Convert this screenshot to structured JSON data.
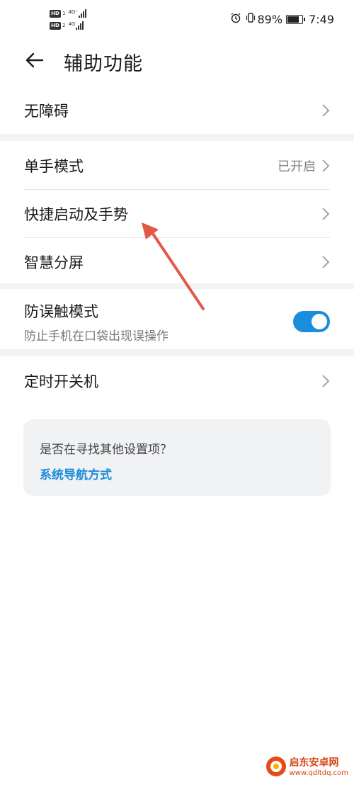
{
  "status_bar": {
    "sim1": {
      "badge": "HD",
      "num": "1",
      "net": "4G⁺"
    },
    "sim2": {
      "badge": "HD",
      "num": "2",
      "net": "4G"
    },
    "battery": "89%",
    "time": "7:49",
    "icons": [
      "alarm-icon",
      "vibrate-icon",
      "battery-icon"
    ]
  },
  "header": {
    "title": "辅助功能",
    "back_icon": "arrow-left-icon"
  },
  "groups": {
    "accessibility": {
      "label": "无障碍"
    },
    "one_hand": {
      "label": "单手模式",
      "value": "已开启"
    },
    "quick_launch": {
      "label": "快捷启动及手势"
    },
    "smart_split": {
      "label": "智慧分屏"
    },
    "anti_mistouch": {
      "label": "防误触模式",
      "sub": "防止手机在口袋出现误操作",
      "toggle_on": true
    },
    "scheduled_power": {
      "label": "定时开关机"
    }
  },
  "suggestion": {
    "question": "是否在寻找其他设置项？",
    "link": "系统导航方式"
  },
  "watermark": {
    "title": "启东安卓网",
    "url": "www.qdltdq.com"
  },
  "colors": {
    "accent": "#1a8ddb",
    "arrow": "#e2594a",
    "band": "#f1f3f5"
  }
}
